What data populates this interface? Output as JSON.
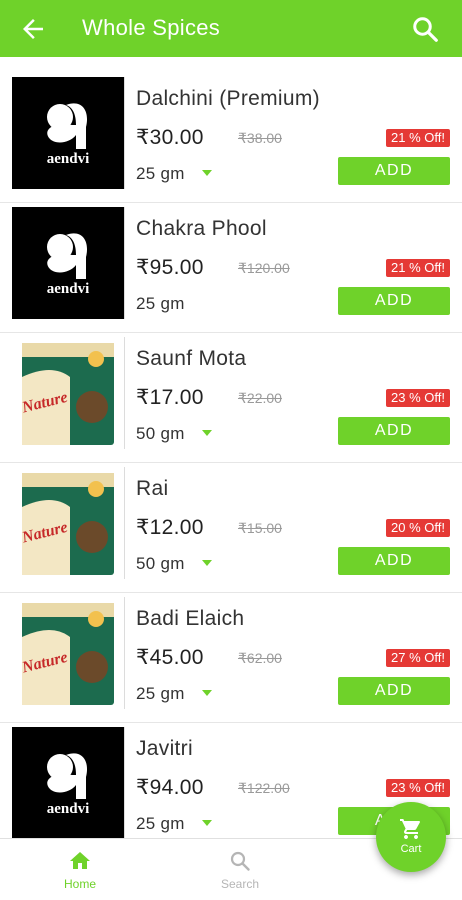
{
  "header": {
    "title": "Whole Spices",
    "back_icon": "back-arrow-icon",
    "search_icon": "search-icon"
  },
  "colors": {
    "accent": "#6fd22a",
    "badge": "#e53935"
  },
  "products": [
    {
      "name": "Dalchini (Premium)",
      "price": "₹30.00",
      "mrp": "₹38.00",
      "discount": "21 % Off!",
      "unit": "25 gm",
      "has_dropdown": true,
      "add_label": "ADD",
      "brand_image": "aendvi",
      "brand_text": "aendvi"
    },
    {
      "name": "Chakra Phool",
      "price": "₹95.00",
      "mrp": "₹120.00",
      "discount": "21 % Off!",
      "unit": "25 gm",
      "has_dropdown": false,
      "add_label": "ADD",
      "brand_image": "aendvi",
      "brand_text": "aendvi"
    },
    {
      "name": "Saunf Mota",
      "price": "₹17.00",
      "mrp": "₹22.00",
      "discount": "23 % Off!",
      "unit": "50 gm",
      "has_dropdown": true,
      "add_label": "ADD",
      "brand_image": "nature",
      "brand_text": "Nature"
    },
    {
      "name": "Rai",
      "price": "₹12.00",
      "mrp": "₹15.00",
      "discount": "20 % Off!",
      "unit": "50 gm",
      "has_dropdown": true,
      "add_label": "ADD",
      "brand_image": "nature",
      "brand_text": "Nature"
    },
    {
      "name": "Badi Elaich",
      "price": "₹45.00",
      "mrp": "₹62.00",
      "discount": "27 % Off!",
      "unit": "25 gm",
      "has_dropdown": true,
      "add_label": "ADD",
      "brand_image": "nature",
      "brand_text": "Nature"
    },
    {
      "name": "Javitri",
      "price": "₹94.00",
      "mrp": "₹122.00",
      "discount": "23 % Off!",
      "unit": "25 gm",
      "has_dropdown": true,
      "add_label": "ADD",
      "brand_image": "aendvi",
      "brand_text": "aendvi"
    }
  ],
  "bottom_nav": {
    "home": {
      "label": "Home",
      "icon": "home-icon"
    },
    "search": {
      "label": "Search",
      "icon": "search-icon"
    }
  },
  "cart": {
    "label": "Cart",
    "icon": "cart-icon"
  }
}
